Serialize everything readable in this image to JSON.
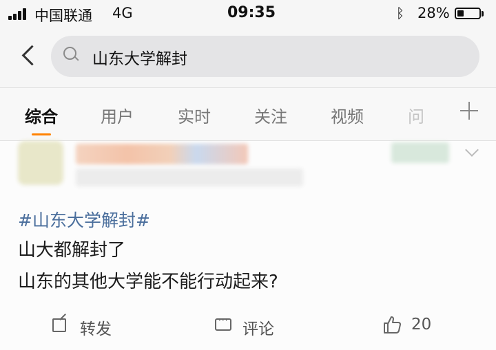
{
  "status_bar": {
    "carrier": "中国联通",
    "network": "4G",
    "time": "09:35",
    "battery": "28%",
    "battery_level": 0.28
  },
  "search": {
    "query": "山东大学解封"
  },
  "tabs": [
    {
      "label": "综合",
      "active": true
    },
    {
      "label": "用户"
    },
    {
      "label": "实时"
    },
    {
      "label": "关注"
    },
    {
      "label": "视频"
    },
    {
      "label": "问"
    }
  ],
  "post": {
    "hashtag": "#山东大学解封#",
    "lines": [
      "山大都解封了",
      "山东的其他大学能不能行动起来?"
    ],
    "actions": {
      "repost": "转发",
      "comment": "评论",
      "likes": "20"
    }
  },
  "colors": {
    "accent": "#ff8200",
    "hashtag": "#4a6e9c"
  }
}
